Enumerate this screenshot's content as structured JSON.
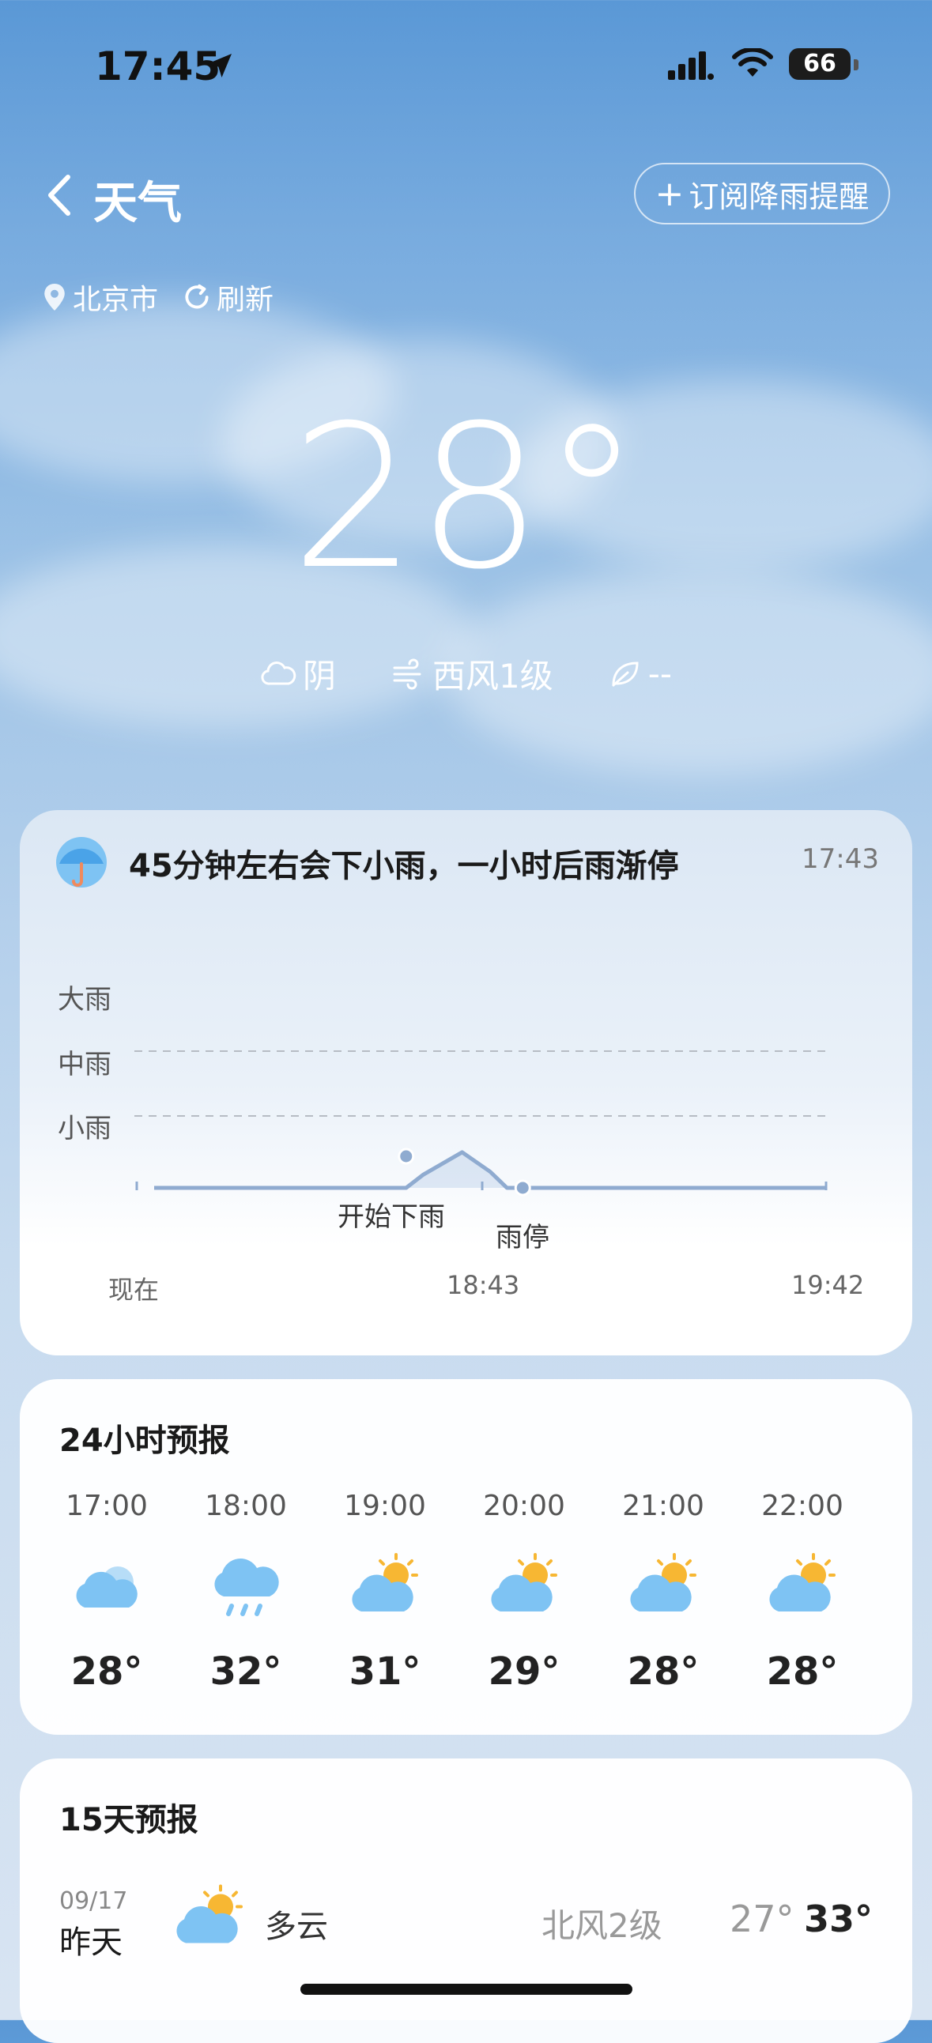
{
  "status_bar": {
    "time": "17:45",
    "battery": "66"
  },
  "header": {
    "back_icon": "chevron-left-icon",
    "title": "天气",
    "subscribe_label": "订阅降雨提醒"
  },
  "location": {
    "city": "北京市",
    "refresh_label": "刷新"
  },
  "current": {
    "temperature": "28°",
    "condition": "阴",
    "wind": "西风1级",
    "air_quality": "--"
  },
  "rain_card": {
    "message": "45分钟左右会下小雨，一小时后雨渐停",
    "updated": "17:43",
    "y_labels": [
      "大雨",
      "中雨",
      "小雨"
    ],
    "x_labels": [
      "现在",
      "18:43",
      "19:42"
    ],
    "annotations": {
      "start": "开始下雨",
      "stop": "雨停"
    }
  },
  "chart_data": {
    "type": "area",
    "title": "45分钟左右会下小雨，一小时后雨渐停",
    "x_ticks": [
      "现在",
      "18:43",
      "19:42"
    ],
    "y_levels": [
      "小雨",
      "中雨",
      "大雨"
    ],
    "x_minutes_from_now": [
      0,
      45,
      48,
      55,
      60,
      63,
      120
    ],
    "intensity": [
      0,
      0,
      0.2,
      0.55,
      0.25,
      0,
      0
    ],
    "annotations": [
      {
        "text": "开始下雨",
        "minute": 45
      },
      {
        "text": "雨停",
        "minute": 63
      }
    ]
  },
  "hourly": {
    "title": "24小时预报",
    "items": [
      {
        "time": "17:00",
        "icon": "cloudy-icon",
        "temp": "28°"
      },
      {
        "time": "18:00",
        "icon": "rain-icon",
        "temp": "32°"
      },
      {
        "time": "19:00",
        "icon": "partly-cloudy-icon",
        "temp": "31°"
      },
      {
        "time": "20:00",
        "icon": "partly-cloudy-icon",
        "temp": "29°"
      },
      {
        "time": "21:00",
        "icon": "partly-cloudy-icon",
        "temp": "28°"
      },
      {
        "time": "22:00",
        "icon": "partly-cloudy-icon",
        "temp": "28°"
      }
    ]
  },
  "daily": {
    "title": "15天预报",
    "items": [
      {
        "date": "09/17",
        "day": "昨天",
        "icon": "partly-cloudy-icon",
        "condition": "多云",
        "wind": "北风2级",
        "low": "27°",
        "high": "33°"
      }
    ]
  },
  "colors": {
    "accent": "#5a98d6",
    "cloud_blue": "#7ec3f3",
    "sun": "#f7b733",
    "line": "#8fabd0"
  }
}
